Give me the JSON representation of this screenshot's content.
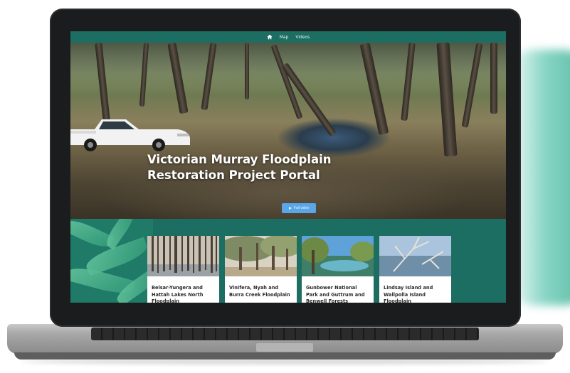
{
  "nav": {
    "home_icon": "home-icon",
    "items": [
      {
        "label": "Map"
      },
      {
        "label": "Videos"
      }
    ]
  },
  "hero": {
    "title_line1": "Victorian Murray Floodplain",
    "title_line2": "Restoration Project Portal",
    "button": {
      "label": "Full video",
      "icon": "play-icon"
    }
  },
  "cards": [
    {
      "title": "Belsar-Yungera and Hattah Lakes North Floodplain"
    },
    {
      "title": "Vinifera, Nyah and Burra Creek Floodplain"
    },
    {
      "title": "Gunbower National Park and Guttrum and Benwell Forests"
    },
    {
      "title": "Lindsay Island and Wallpolla Island Floodplain"
    }
  ],
  "colors": {
    "brand_teal": "#1d6e62",
    "button_blue": "#5aa6e6"
  }
}
